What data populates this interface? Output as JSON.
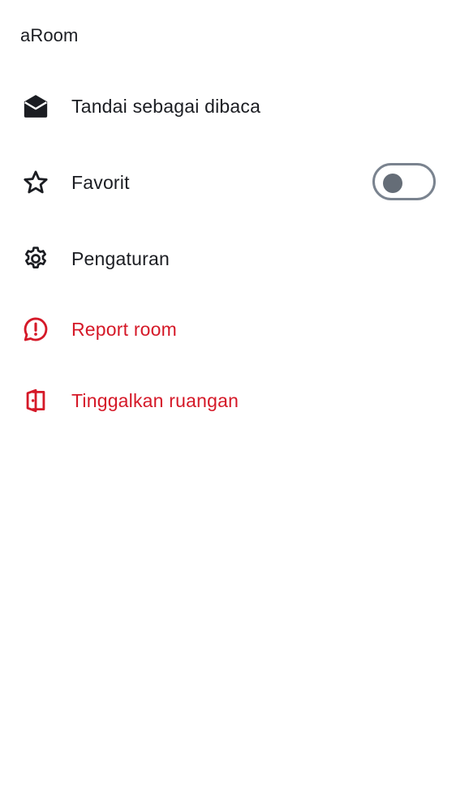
{
  "room": {
    "title": "aRoom"
  },
  "menu": {
    "items": [
      {
        "label": "Tandai sebagai dibaca",
        "icon": "mail-open-icon"
      },
      {
        "label": "Favorit",
        "icon": "star-outline-icon",
        "toggle_on": false
      },
      {
        "label": "Pengaturan",
        "icon": "gear-icon"
      },
      {
        "label": "Report room",
        "icon": "report-chat-icon",
        "danger": true
      },
      {
        "label": "Tinggalkan ruangan",
        "icon": "leave-door-icon",
        "danger": true
      }
    ]
  },
  "colors": {
    "text": "#1b1d22",
    "danger": "#d51928",
    "toggle_border": "#7a838f",
    "toggle_knob": "#656d77"
  }
}
